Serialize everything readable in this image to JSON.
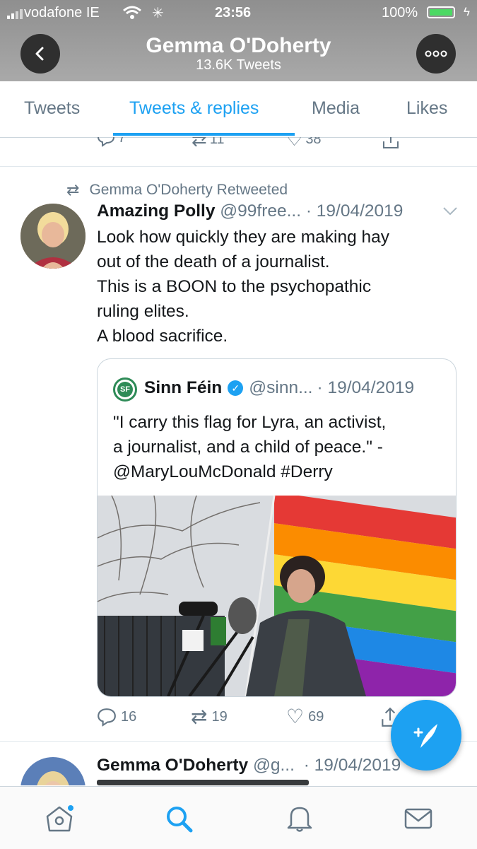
{
  "status_bar": {
    "carrier": "vodafone IE",
    "time": "23:56",
    "battery": "100%"
  },
  "profile_header": {
    "name": "Gemma O'Doherty",
    "tweet_count": "13.6K Tweets"
  },
  "tabs": [
    {
      "label": "Tweets"
    },
    {
      "label": "Tweets & replies"
    },
    {
      "label": "Media"
    },
    {
      "label": "Likes"
    }
  ],
  "prev_tweet_actions": {
    "replies": "7",
    "retweets": "11",
    "likes": "38"
  },
  "retweet": {
    "context": "Gemma O'Doherty Retweeted",
    "author_name": "Amazing Polly",
    "author_handle": "@99free...",
    "date": "· 19/04/2019",
    "text_lines": [
      "Look how quickly they are making hay",
      "out of the death of a journalist.",
      "This is a BOON to the psychopathic",
      "ruling elites.",
      "A blood sacrifice."
    ],
    "quote": {
      "author_name": "Sinn Féin",
      "author_handle": "@sinn...",
      "date": "· 19/04/2019",
      "text_lines": [
        "\"I carry this flag for Lyra, an activist,",
        "a journalist, and a child of peace.\" -",
        "@MaryLouMcDonald #Derry"
      ]
    },
    "actions": {
      "replies": "16",
      "retweets": "19",
      "likes": "69"
    }
  },
  "next_tweet": {
    "author_name": "Gemma O'Doherty",
    "author_handle": "@g...",
    "date": "· 19/04/2019"
  },
  "colors": {
    "accent": "#1da1f2",
    "text": "#14171a",
    "secondary": "#657786",
    "verified": "#1da1f2"
  }
}
